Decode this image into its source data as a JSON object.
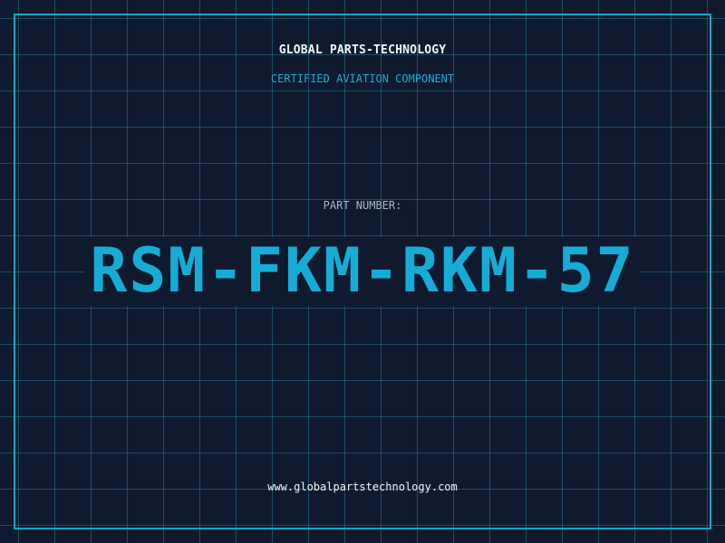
{
  "header": {
    "company_name": "GLOBAL PARTS-TECHNOLOGY",
    "subtitle": "CERTIFIED AVIATION COMPONENT"
  },
  "part": {
    "label": "PART NUMBER:",
    "number": "RSM-FKM-RKM-57"
  },
  "footer": {
    "website": "www.globalpartstechnology.com"
  },
  "colors": {
    "background": "#0f1a2e",
    "grid": "#227896",
    "accent": "#16acd6",
    "frame": "#1aa3c8",
    "text_primary": "#f2f5f8",
    "text_muted": "#a9b6c4"
  }
}
